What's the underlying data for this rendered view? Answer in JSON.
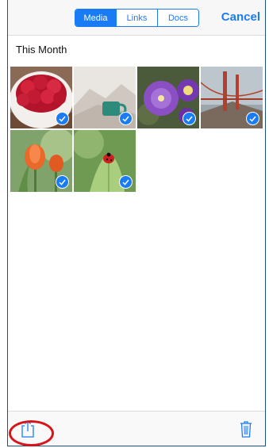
{
  "header": {
    "tabs": [
      {
        "label": "Media",
        "active": true
      },
      {
        "label": "Links",
        "active": false
      },
      {
        "label": "Docs",
        "active": false
      }
    ],
    "cancel_label": "Cancel"
  },
  "section": {
    "title": "This Month"
  },
  "media": {
    "items": [
      {
        "subject": "raspberries in white cup",
        "selected": true
      },
      {
        "subject": "coffee cup with mountains",
        "selected": true
      },
      {
        "subject": "purple petunia flowers",
        "selected": true
      },
      {
        "subject": "golden gate bridge in fog",
        "selected": true
      },
      {
        "subject": "orange tulips",
        "selected": true
      },
      {
        "subject": "ladybug on leaf",
        "selected": true
      }
    ]
  },
  "toolbar": {
    "share_icon": "share-icon",
    "trash_icon": "trash-icon"
  },
  "colors": {
    "accent": "#1a7cf5",
    "highlight": "#d8141b"
  }
}
